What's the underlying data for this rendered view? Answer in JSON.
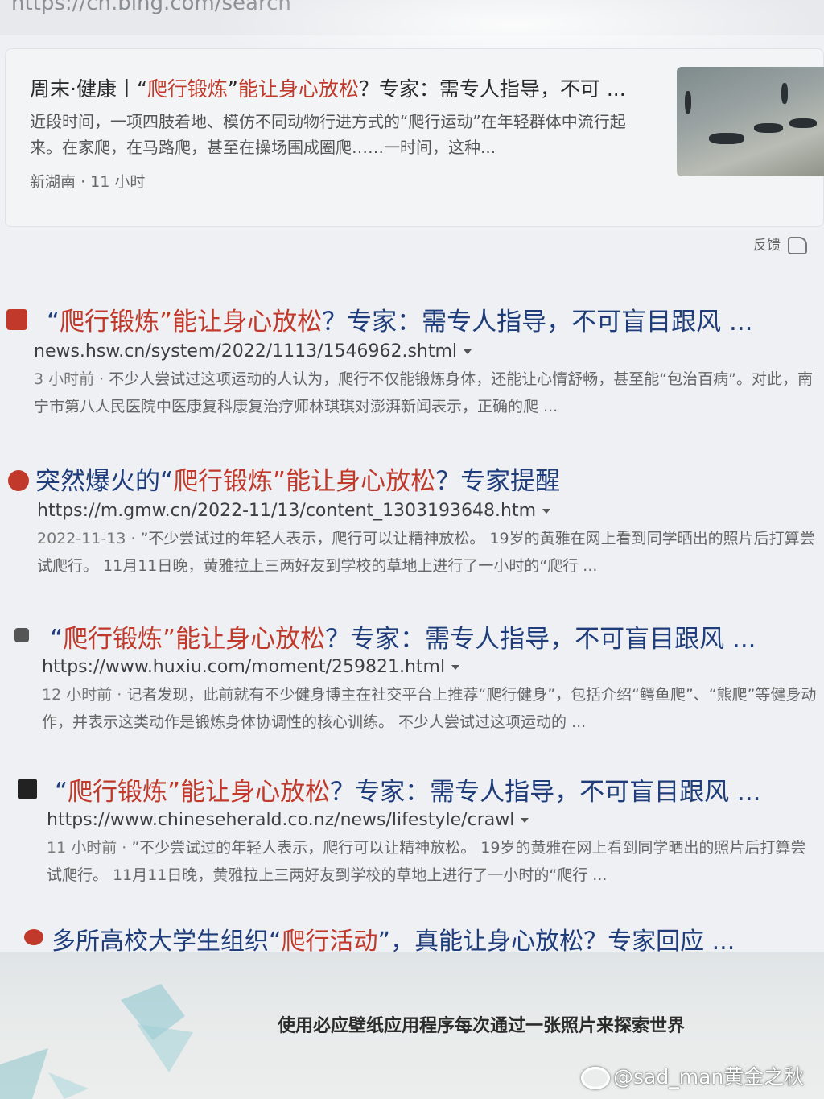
{
  "browser": {
    "url": "https://cn.bing.com/search"
  },
  "news_card": {
    "title_pre": "周末·健康丨“",
    "title_hl": "爬行锻炼",
    "title_mid": "”",
    "title_hl2": "能让身心放松",
    "title_post": "？专家：需专人指导，不可 ...",
    "snippet": "近段时间，一项四肢着地、模仿不同动物行进方式的“爬行运动”在年轻群体中流行起来。在家爬，在马路爬，甚至在操场围成圈爬……一时间，这种...",
    "source": "新湖南",
    "time": "11 小时"
  },
  "feedback": {
    "label": "反馈"
  },
  "results": [
    {
      "title_pre": "“",
      "title_hl": "爬行锻炼”能让身心放松",
      "title_post": "？专家：需专人指导，不可盲目跟风 ...",
      "url": "news.hsw.cn/system/2022/1113/1546962.shtml",
      "date": "3 小时前 ·",
      "snippet": "不少人尝试过这项运动的人认为，爬行不仅能锻炼身体，还能让心情舒畅，甚至能“包治百病”。对此，南宁市第八人民医院中医康复科康复治疗师林琪琪对澎湃新闻表示，正确的爬 ...",
      "favicon_color": "#c0392b"
    },
    {
      "title_pre": "突然爆火的“",
      "title_hl": "爬行锻炼”能让身心放松",
      "title_post": "？专家提醒",
      "url": "https://m.gmw.cn/2022-11/13/content_1303193648.htm",
      "date": "2022-11-13 ·",
      "snippet": "”不少尝试过的年轻人表示，爬行可以让精神放松。 19岁的黄雅在网上看到同学晒出的照片后打算尝试爬行。 11月11日晚，黄雅拉上三两好友到学校的草地上进行了一小时的“爬行 ...",
      "favicon_color": "#c0392b"
    },
    {
      "title_pre": "“",
      "title_hl": "爬行锻炼”能让身心放松",
      "title_post": "？专家：需专人指导，不可盲目跟风 ...",
      "url": "https://www.huxiu.com/moment/259821.html",
      "date": "12 小时前 ·",
      "snippet": "记者发现，此前就有不少健身博主在社交平台上推荐“爬行健身”，包括介绍“鳄鱼爬”、“熊爬”等健身动作，并表示这类动作是锻炼身体协调性的核心训练。 不少人尝试过这项运动的 ...",
      "favicon_color": "#555555"
    },
    {
      "title_pre": "“",
      "title_hl": "爬行锻炼”能让身心放松",
      "title_post": "？专家：需专人指导，不可盲目跟风 ...",
      "url": "https://www.chineseherald.co.nz/news/lifestyle/crawl",
      "date": "11 小时前 ·",
      "snippet": "”不少尝试过的年轻人表示，爬行可以让精神放松。 19岁的黄雅在网上看到同学晒出的照片后打算尝试爬行。 11月11日晚，黄雅拉上三两好友到学校的草地上进行了一小时的“爬行 ...",
      "favicon_color": "#222222"
    },
    {
      "title_pre": "多所高校大学生组织“",
      "title_hl": "爬行活动",
      "title_post": "”，真能让身心放松？专家回应 ...",
      "url": "",
      "date": "",
      "snippet": "",
      "favicon_color": "#c0392b"
    }
  ],
  "wallpaper": {
    "caption": "使用必应壁纸应用程序每次通过一张照片来探索世界"
  },
  "watermark": {
    "text": "@sad_man黄金之秋"
  }
}
